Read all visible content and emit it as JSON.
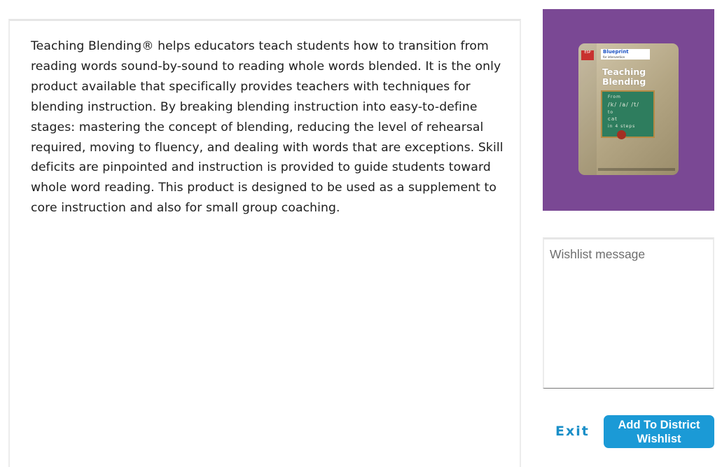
{
  "description": {
    "text": "Teaching Blending® helps educators teach students how to transition from reading words sound-by-sound to reading whole words blended. It is the only product available that specifically provides teachers with techniques for blending instruction. By breaking blending instruction into easy-to-define stages: mastering the concept of blending, reducing the level of rehearsal required, moving to fluency, and dealing with words that are exceptions. Skill deficits are pinpointed and instruction is provided to guide students toward whole word reading. This product is designed to be used as a supplement to core instruction and also for small group coaching."
  },
  "product_cover": {
    "background_color": "#7a4894",
    "series_label": "Blueprint",
    "series_sublabel": "for intervention",
    "title": "Teaching Blending",
    "chalkboard_lines": [
      "From",
      "/k/ /a/ /t/",
      "to",
      "cat",
      "in 4 steps"
    ]
  },
  "wishlist": {
    "placeholder": "Wishlist message",
    "value": ""
  },
  "actions": {
    "exit_label": "Exit",
    "add_label": "Add To District Wishlist",
    "accent_color": "#1b9ad6"
  }
}
